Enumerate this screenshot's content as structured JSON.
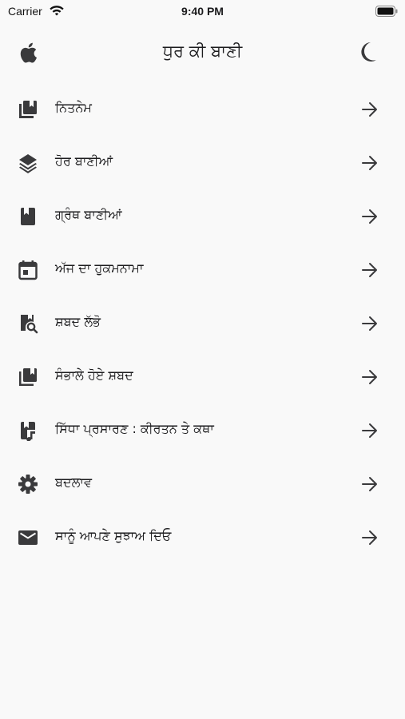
{
  "status_bar": {
    "carrier": "Carrier",
    "time": "9:40 PM"
  },
  "header": {
    "title": "ਧੁਰ ਕੀ ਬਾਣੀ",
    "left_icon": "apple-icon",
    "right_icon": "moon-icon"
  },
  "menu": {
    "items": [
      {
        "label": "ਨਿਤਨੇਮ",
        "icon": "book-icon"
      },
      {
        "label": "ਹੋਰ ਬਾਣੀਆਂ",
        "icon": "layers-icon"
      },
      {
        "label": "ਗ੍ਰੰਥ ਬਾਣੀਆਂ",
        "icon": "bookmark-book-icon"
      },
      {
        "label": "ਅੱਜ ਦਾ ਹੁਕਮਨਾਮਾ",
        "icon": "calendar-icon"
      },
      {
        "label": "ਸ਼ਬਦ ਲੱਭੋ",
        "icon": "book-search-icon"
      },
      {
        "label": "ਸੰਭਾਲੇ ਹੋਏ ਸ਼ਬਦ",
        "icon": "library-bookmark-icon"
      },
      {
        "label": "ਸਿੱਧਾ ਪ੍ਰਸਾਰਣ : ਕੀਰਤਨ ਤੇ ਕਥਾ",
        "icon": "book-music-icon"
      },
      {
        "label": "ਬਦਲਾਵ",
        "icon": "gear-icon"
      },
      {
        "label": "ਸਾਨੂੰ ਆਪਣੇ ਸੁਝਾਅ ਦਿਓ",
        "icon": "mail-icon"
      }
    ],
    "arrow_icon": "arrow-right-icon"
  },
  "colors": {
    "background": "#f9f9f9",
    "text": "#1c1c1e",
    "icon": "#3a3a3c"
  }
}
